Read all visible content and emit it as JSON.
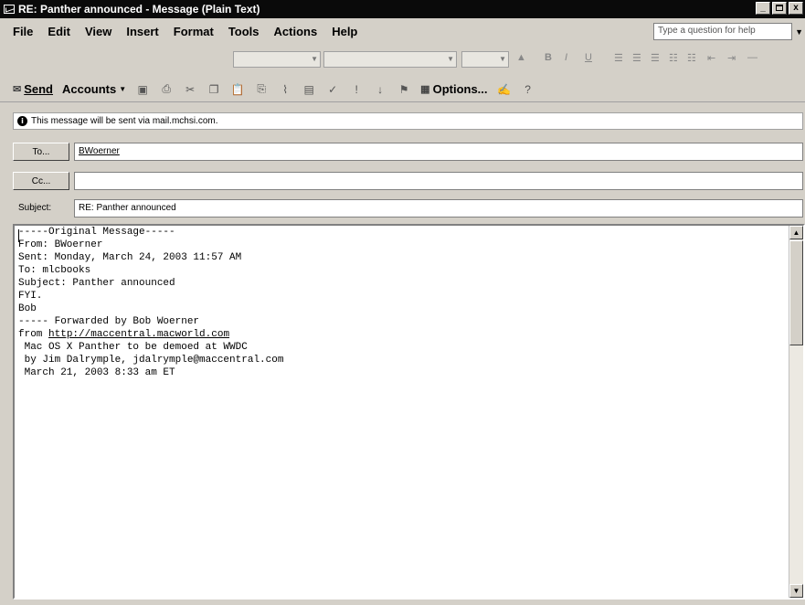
{
  "window": {
    "title": "RE: Panther announced - Message (Plain Text)",
    "controls": [
      "_",
      " ",
      "x"
    ]
  },
  "menu": {
    "items": [
      "File",
      "Edit",
      "View",
      "Insert",
      "Format",
      "Tools",
      "Actions",
      "Help"
    ],
    "help_placeholder": "Type a question for help"
  },
  "toolbar": {
    "send_label": "Send",
    "accounts_label": "Accounts",
    "options_label": "Options..."
  },
  "info": {
    "text": "This message will be sent via mail.mchsi.com."
  },
  "fields": {
    "to_label": "To...",
    "to_value": "BWoerner",
    "cc_label": "Cc...",
    "cc_value": "",
    "subject_label": "Subject:",
    "subject_value": "RE: Panther announced"
  },
  "body": {
    "lines": [
      "",
      "",
      "-----Original Message-----",
      "From: BWoerner",
      "Sent: Monday, March 24, 2003 11:57 AM",
      "To: mlcbooks",
      "Subject: Panther announced",
      "",
      "",
      "FYI.",
      "",
      "Bob",
      "",
      "----- Forwarded by Bob Woerner",
      "",
      "from ",
      "",
      "",
      " Mac OS X Panther to be demoed at WWDC",
      " by Jim Dalrymple, jdalrymple@maccentral.com",
      " March 21, 2003 8:33 am ET"
    ],
    "link": "http://maccentral.macworld.com"
  }
}
